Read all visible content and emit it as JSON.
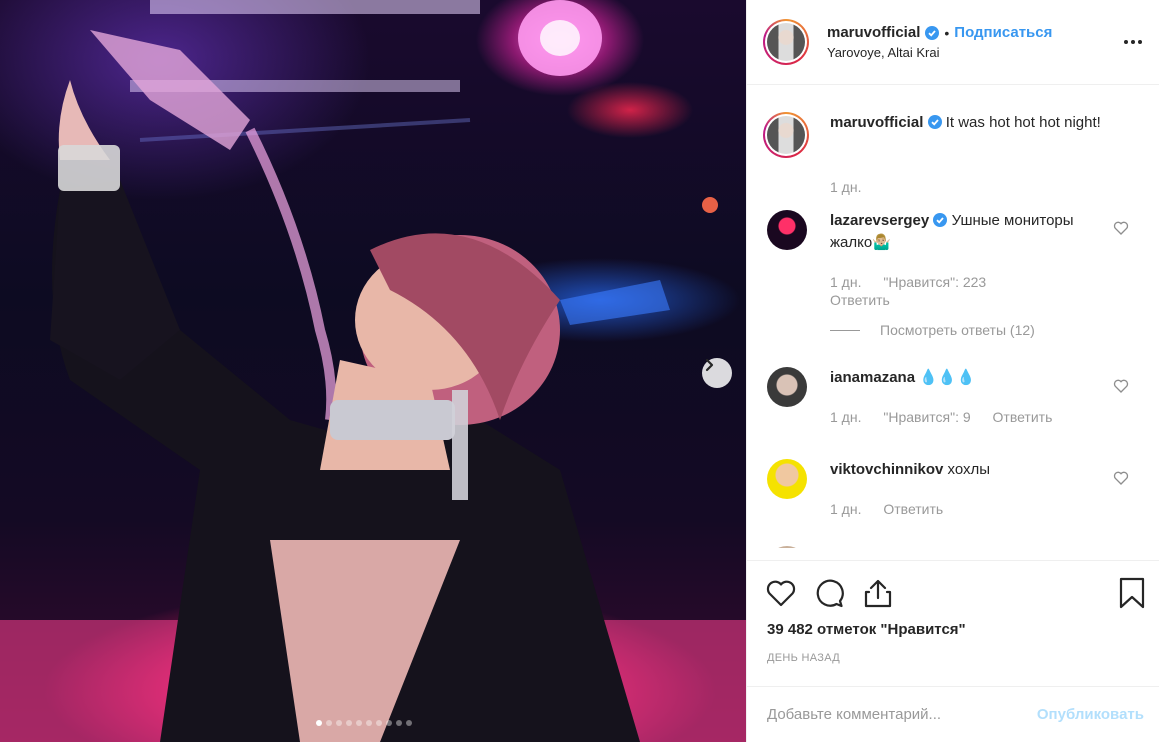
{
  "post": {
    "author": "maruvofficial",
    "location": "Yarovoye, Altai Krai",
    "follow_label": "Подписаться",
    "separator": "•",
    "caption_text": "It was hot hot hot night!",
    "caption_time": "1 дн.",
    "photo_count": 10,
    "active_photo": 1
  },
  "comments": [
    {
      "user": "lazarevsergey",
      "verified": true,
      "text": "Ушные мониторы жалко🤷🏼‍♂️",
      "time": "1 дн.",
      "likes": "\"Нравится\": 223",
      "reply": "Ответить",
      "view_replies": "Посмотреть ответы (12)"
    },
    {
      "user": "ianamazana",
      "verified": false,
      "text": "💧💧💧",
      "time": "1 дн.",
      "likes": "\"Нравится\": 9",
      "reply": "Ответить"
    },
    {
      "user": "viktovchinnikov",
      "verified": false,
      "text": "хохлы",
      "time": "1 дн.",
      "reply": "Ответить"
    }
  ],
  "stats": {
    "likes_text": "39 482 отметок \"Нравится\"",
    "date_text": "ДЕНЬ НАЗАД"
  },
  "composer": {
    "placeholder": "Добавьте комментарий...",
    "publish_label": "Опубликовать"
  },
  "colors": {
    "link": "#3897f0",
    "muted": "#999999",
    "publish_disabled": "#b2dffc"
  },
  "icons": [
    "heart-icon",
    "comment-icon",
    "share-icon",
    "bookmark-icon",
    "more-icon",
    "verified-icon",
    "chevron-right-icon"
  ]
}
